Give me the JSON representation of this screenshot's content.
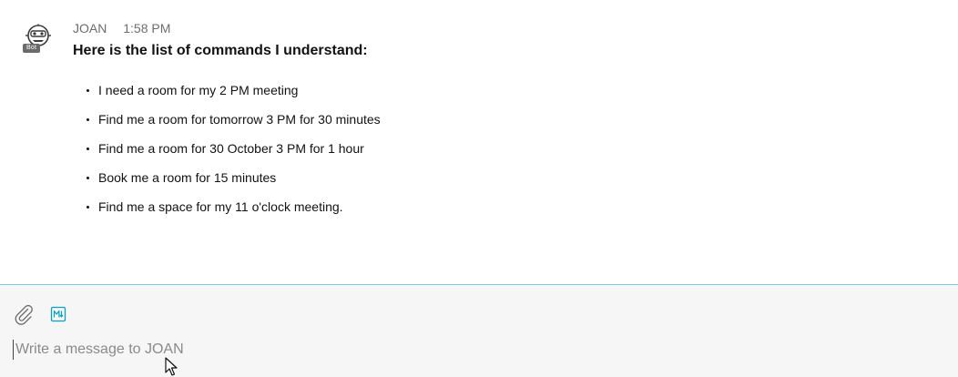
{
  "message": {
    "sender": "JOAN",
    "time": "1:58 PM",
    "badge": "Bot",
    "title": "Here is the list of commands I understand:",
    "commands": [
      "I need a room for my 2 PM meeting",
      "Find me a room for tomorrow 3 PM for 30 minutes",
      "Find me a room for 30 October 3 PM for 1 hour",
      "Book me a room for 15 minutes",
      "Find me a space for my 11 o'clock meeting."
    ]
  },
  "composer": {
    "placeholder": "Write a message to JOAN",
    "value": "",
    "tools": [
      {
        "icon": "paperclip-icon",
        "label": "Attach file"
      },
      {
        "icon": "markdown-icon",
        "label": "Markdown"
      }
    ]
  },
  "colors": {
    "accent": "#6fd3db",
    "markdown_icon": "#0a9fbd",
    "badge_bg": "#6b6b6b",
    "composer_bg": "#f6f6f6"
  }
}
